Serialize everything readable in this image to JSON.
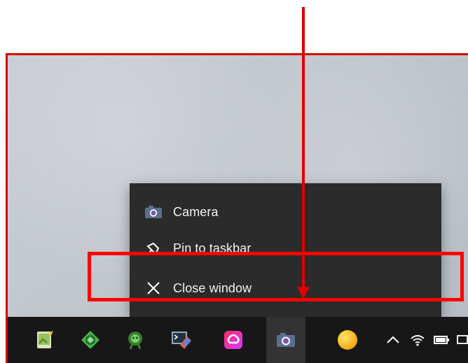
{
  "context_menu": {
    "items": [
      {
        "label": "Camera",
        "icon": "camera-icon"
      },
      {
        "label": "Pin to taskbar",
        "icon": "pin-icon"
      },
      {
        "label": "Close window",
        "icon": "close-icon"
      }
    ]
  },
  "taskbar": {
    "icons": [
      {
        "name": "notepad-plus-plus-icon"
      },
      {
        "name": "android-studio-icon"
      },
      {
        "name": "android-dev-icon"
      },
      {
        "name": "devtools-icon"
      },
      {
        "name": "creative-cloud-icon"
      },
      {
        "name": "camera-taskbar-icon",
        "active": true
      },
      {
        "name": "yellow-circle-icon"
      }
    ],
    "tray": [
      {
        "name": "chevron-up-icon"
      },
      {
        "name": "wifi-icon"
      },
      {
        "name": "battery-icon"
      },
      {
        "name": "notification-icon"
      }
    ]
  },
  "annotation": {
    "highlight_color": "#ff0000",
    "arrow_color": "#e00000"
  }
}
